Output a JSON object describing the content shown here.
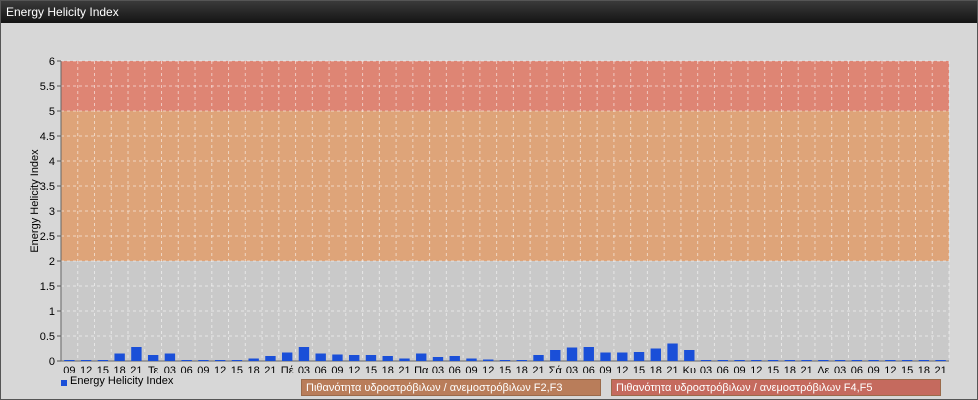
{
  "window": {
    "title": "Energy Helicity Index"
  },
  "chart_data": {
    "type": "bar",
    "ylabel": "Energy Helicity Index",
    "ylim": [
      0,
      6
    ],
    "yticks": [
      "0",
      "0.5",
      "1",
      "1.5",
      "2",
      "2.5",
      "3",
      "3.5",
      "4",
      "4.5",
      "5",
      "5.5",
      "6"
    ],
    "categories": [
      "09",
      "12",
      "15",
      "18",
      "21",
      "Τε",
      "03",
      "06",
      "09",
      "12",
      "15",
      "18",
      "21",
      "Πέ",
      "03",
      "06",
      "09",
      "12",
      "15",
      "18",
      "21",
      "Πα",
      "03",
      "06",
      "09",
      "12",
      "15",
      "18",
      "21",
      "Σά",
      "03",
      "06",
      "09",
      "12",
      "15",
      "18",
      "21",
      "Κυ",
      "03",
      "06",
      "09",
      "12",
      "15",
      "18",
      "21",
      "Δε",
      "03",
      "06",
      "09",
      "12",
      "15",
      "18",
      "21"
    ],
    "series": [
      {
        "name": "Energy Helicity Index",
        "color": "#1a4fd8",
        "values": [
          0.02,
          0.02,
          0.02,
          0.15,
          0.28,
          0.12,
          0.15,
          0.02,
          0.02,
          0.02,
          0.02,
          0.05,
          0.1,
          0.17,
          0.28,
          0.15,
          0.13,
          0.12,
          0.12,
          0.1,
          0.05,
          0.15,
          0.08,
          0.1,
          0.05,
          0.03,
          0.02,
          0.02,
          0.12,
          0.22,
          0.27,
          0.28,
          0.17,
          0.17,
          0.18,
          0.25,
          0.35,
          0.22,
          0.02,
          0.02,
          0.02,
          0.02,
          0.02,
          0.02,
          0.02,
          0.02,
          0.02,
          0.02,
          0.02,
          0.02,
          0.02,
          0.02,
          0.02
        ]
      }
    ],
    "bands": [
      {
        "from": 2,
        "to": 5,
        "color": "#e0a070",
        "label": "Πιθανότητα υδροστρόβιλων / ανεμοστρόβιλων F2,F3"
      },
      {
        "from": 5,
        "to": 6,
        "color": "#e07d6a",
        "label": "Πιθανότητα υδροστρόβιλων / ανεμοστρόβιλων F4,F5"
      }
    ],
    "grid": true,
    "legend_position": "bottom-left"
  }
}
